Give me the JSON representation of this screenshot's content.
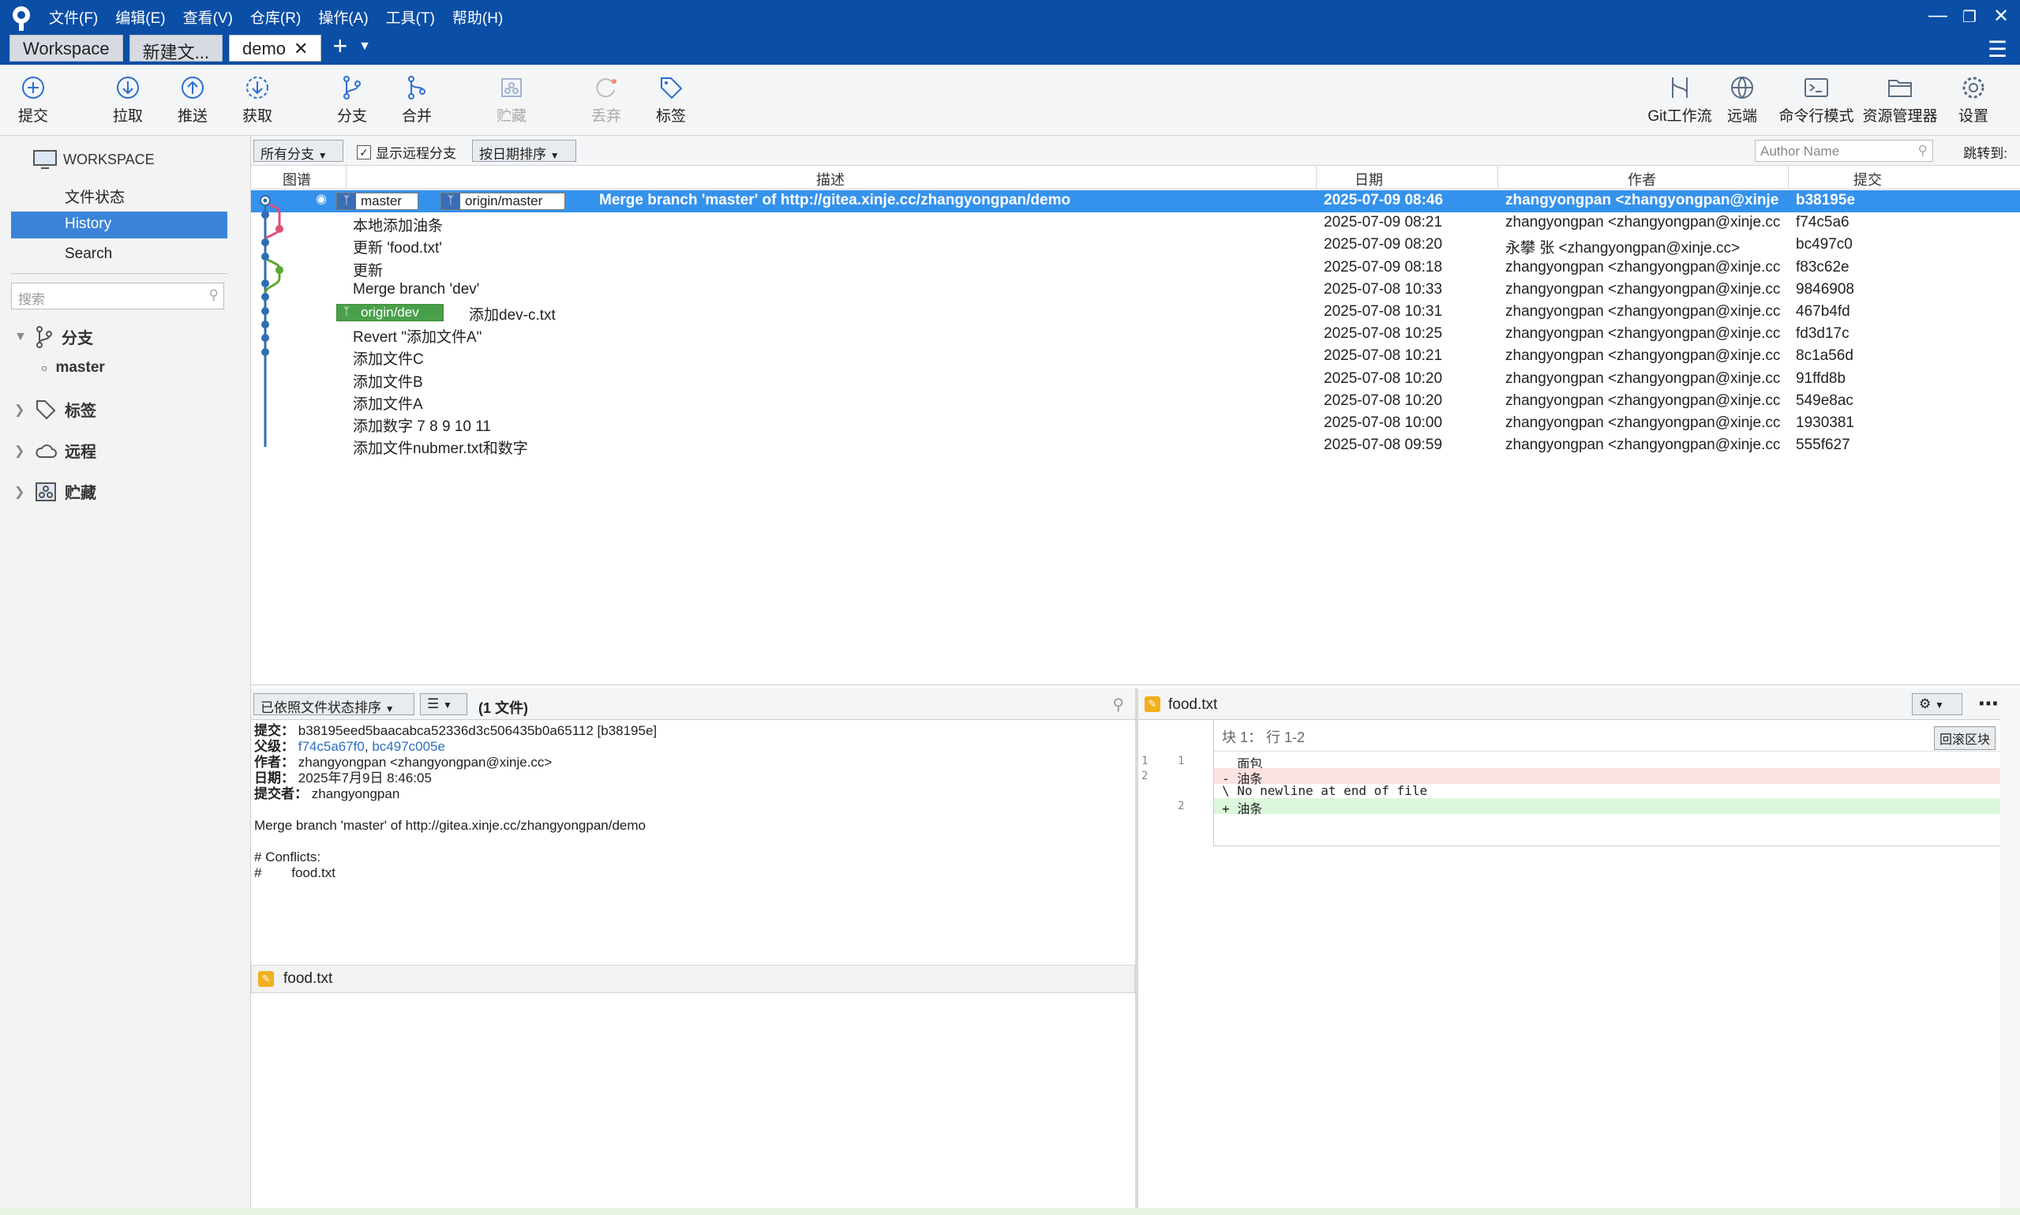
{
  "menu": [
    "文件(F)",
    "编辑(E)",
    "查看(V)",
    "仓库(R)",
    "操作(A)",
    "工具(T)",
    "帮助(H)"
  ],
  "tabs": [
    {
      "label": "Workspace"
    },
    {
      "label": "新建文..."
    },
    {
      "label": "demo"
    }
  ],
  "toolbar": {
    "commit": "提交",
    "pull": "拉取",
    "push": "推送",
    "fetch": "获取",
    "branch": "分支",
    "merge": "合并",
    "stash": "贮藏",
    "discard": "丢弃",
    "tag": "标签",
    "gitflow": "Git工作流",
    "remote": "远端",
    "terminal": "命令行模式",
    "explorer": "资源管理器",
    "settings": "设置"
  },
  "sidebar": {
    "workspace": "WORKSPACE",
    "file_status": "文件状态",
    "history": "History",
    "search": "Search",
    "search_placeholder": "搜索",
    "branches": "分支",
    "current_branch": "master",
    "tags": "标签",
    "remotes": "远程",
    "stashes": "贮藏"
  },
  "filter": {
    "branches": "所有分支",
    "show_remote": "显示远程分支",
    "sort": "按日期排序",
    "author_placeholder": "Author Name",
    "jump_to": "跳转到:"
  },
  "columns": {
    "graph": "图谱",
    "desc": "描述",
    "date": "日期",
    "author": "作者",
    "commit": "提交"
  },
  "commits": [
    {
      "refs": [
        "master",
        "origin/master"
      ],
      "desc": "Merge branch 'master' of http://gitea.xinje.cc/zhangyongpan/demo",
      "date": "2025-07-09 08:46",
      "author": "zhangyongpan <zhangyongpan@xinje",
      "hash": "b38195e"
    },
    {
      "desc": "本地添加油条",
      "date": "2025-07-09 08:21",
      "author": "zhangyongpan <zhangyongpan@xinje.cc",
      "hash": "f74c5a6"
    },
    {
      "desc": "更新 'food.txt'",
      "date": "2025-07-09 08:20",
      "author": "永攀 张 <zhangyongpan@xinje.cc>",
      "hash": "bc497c0"
    },
    {
      "desc": "更新",
      "date": "2025-07-09 08:18",
      "author": "zhangyongpan <zhangyongpan@xinje.cc",
      "hash": "f83c62e"
    },
    {
      "desc": "Merge branch 'dev'",
      "date": "2025-07-08 10:33",
      "author": "zhangyongpan <zhangyongpan@xinje.cc",
      "hash": "9846908"
    },
    {
      "refs": [
        "origin/dev"
      ],
      "desc": "添加dev-c.txt",
      "date": "2025-07-08 10:31",
      "author": "zhangyongpan <zhangyongpan@xinje.cc",
      "hash": "467b4fd"
    },
    {
      "desc": "Revert \"添加文件A\"",
      "date": "2025-07-08 10:25",
      "author": "zhangyongpan <zhangyongpan@xinje.cc",
      "hash": "fd3d17c"
    },
    {
      "desc": "添加文件C",
      "date": "2025-07-08 10:21",
      "author": "zhangyongpan <zhangyongpan@xinje.cc",
      "hash": "8c1a56d"
    },
    {
      "desc": "添加文件B",
      "date": "2025-07-08 10:20",
      "author": "zhangyongpan <zhangyongpan@xinje.cc",
      "hash": "91ffd8b"
    },
    {
      "desc": "添加文件A",
      "date": "2025-07-08 10:20",
      "author": "zhangyongpan <zhangyongpan@xinje.cc",
      "hash": "549e8ac"
    },
    {
      "desc": "添加数字 7 8 9 10 11",
      "date": "2025-07-08 10:00",
      "author": "zhangyongpan <zhangyongpan@xinje.cc",
      "hash": "1930381"
    },
    {
      "desc": "添加文件nubmer.txt和数字",
      "date": "2025-07-08 09:59",
      "author": "zhangyongpan <zhangyongpan@xinje.cc",
      "hash": "555f627"
    }
  ],
  "details_bar": {
    "sort": "已依照文件状态排序",
    "count": "(1 文件)"
  },
  "details": {
    "commit_label": "提交：",
    "commit": "b38195eed5baacabca52336d3c506435b0a65112 [b38195e]",
    "parents_label": "父级：",
    "parent1": "f74c5a67f0",
    "parent2": "bc497c005e",
    "author_label": "作者：",
    "author": "zhangyongpan <zhangyongpan@xinje.cc>",
    "date_label": "日期：",
    "date": "2025年7月9日 8:46:05",
    "committer_label": "提交者：",
    "committer": "zhangyongpan",
    "message": "Merge branch 'master' of http://gitea.xinje.cc/zhangyongpan/demo",
    "conflicts": "# Conflicts:",
    "conflict_file": "#        food.txt"
  },
  "file": {
    "name": "food.txt"
  },
  "diff": {
    "file": "food.txt",
    "hunk": "块 1： 行 1-2",
    "revert": "回滚区块",
    "lines": [
      {
        "type": "ctx",
        "text": "  面包",
        "old": "1",
        "new": "1"
      },
      {
        "type": "del",
        "text": "- 油条",
        "old": "2",
        "new": ""
      },
      {
        "type": "ctx",
        "text": "\\ No newline at end of file",
        "old": "",
        "new": ""
      },
      {
        "type": "add",
        "text": "+ 油条",
        "old": "",
        "new": "2"
      }
    ]
  }
}
